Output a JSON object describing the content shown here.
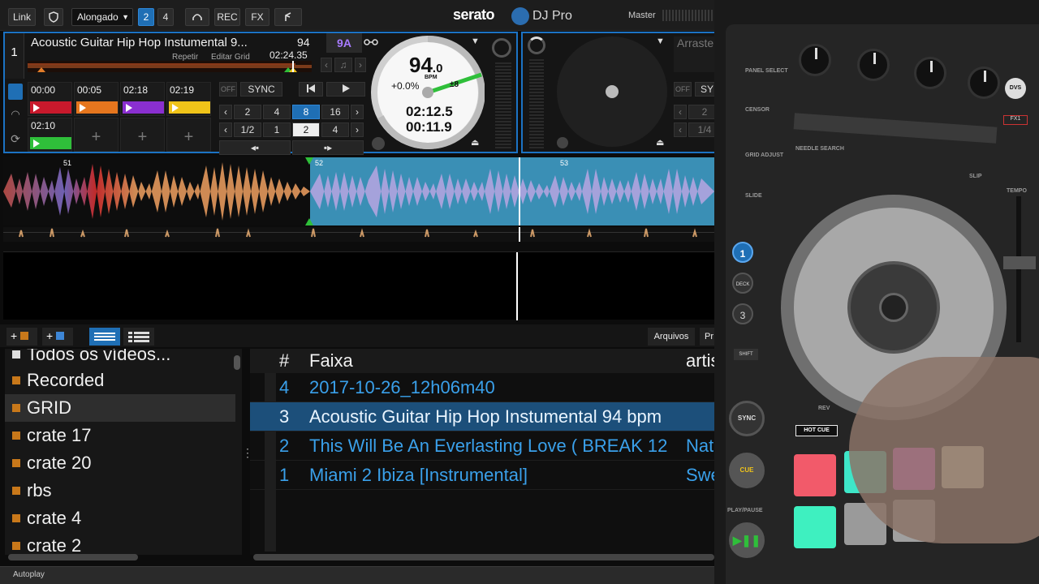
{
  "topbar": {
    "link": "Link",
    "mode_select": "Alongado",
    "deck_count_2": "2",
    "deck_count_4": "4",
    "rec": "REC",
    "fx": "FX",
    "brand": "serato",
    "brand_sub": "DJ Pro",
    "master": "Master"
  },
  "deck1": {
    "number": "1",
    "title": "Acoustic Guitar Hip Hop Instumental 9...",
    "bpm": "94",
    "key": "9A",
    "repeat": "Repetir",
    "edit_grid": "Editar Grid",
    "position": "02:24.35",
    "sync": "SYNC",
    "off": "OFF",
    "cues": [
      {
        "time": "00:00",
        "color": "#c8192c"
      },
      {
        "time": "00:05",
        "color": "#e6761e"
      },
      {
        "time": "02:18",
        "color": "#8a2fd0"
      },
      {
        "time": "02:19",
        "color": "#f0c419"
      },
      {
        "time": "02:10",
        "color": "#2fbf3a"
      }
    ],
    "loop_row1": [
      "2",
      "4",
      "8",
      "16"
    ],
    "loop_row2": [
      "1/2",
      "1",
      "2",
      "4"
    ],
    "platter": {
      "bpm": "94",
      "bpm_decimal": ".0",
      "bpm_label": "BPM",
      "pitch": "+0.0%",
      "range": "±8",
      "elapsed": "02:12.5",
      "remaining": "00:11.9"
    }
  },
  "deck2": {
    "placeholder": "Arraste",
    "off": "OFF",
    "sync": "SY",
    "loop_row1": [
      "2"
    ],
    "loop_row2": [
      "1/4"
    ]
  },
  "waveform": {
    "bar_markers": [
      "51",
      "52",
      "53"
    ]
  },
  "library": {
    "files_button": "Arquivos",
    "prepare_button": "Pr",
    "crates": [
      {
        "label": "Todos os vídeos..."
      },
      {
        "label": "Recorded"
      },
      {
        "label": "GRID",
        "selected": true
      },
      {
        "label": "crate 17"
      },
      {
        "label": "crate 20"
      },
      {
        "label": "rbs"
      },
      {
        "label": "crate 4"
      },
      {
        "label": "crate 2"
      }
    ],
    "columns": {
      "num": "#",
      "track": "Faixa",
      "artist": "artis"
    },
    "tracks": [
      {
        "num": "4",
        "track": "2017-10-26_12h06m40",
        "artist": ""
      },
      {
        "num": "3",
        "track": "Acoustic Guitar Hip Hop Instumental 94 bpm",
        "artist": "",
        "selected": true
      },
      {
        "num": "2",
        "track": "This Will Be An Everlasting Love ( BREAK 12",
        "artist": "Nat"
      },
      {
        "num": "1",
        "track": "Miami 2 Ibiza [Instrumental]",
        "artist": "Swe"
      }
    ],
    "autoplay": "Autoplay"
  },
  "controller": {
    "panel_select": "PANEL SELECT",
    "censor": "CENSOR",
    "grid_adjust": "GRID ADJUST",
    "slide": "SLIDE",
    "needle_search": "NEEDLE SEARCH",
    "deck1": "1",
    "deck": "DECK",
    "deck3": "3",
    "shift": "SHIFT",
    "sync": "SYNC",
    "cue": "CUE",
    "play_pause": "PLAY/PAUSE",
    "hot_cue": "HOT CUE",
    "fx1": "FX1",
    "dvs": "DVS",
    "tempo": "TEMPO",
    "slip": "SLIP",
    "rev": "REV",
    "pad_colors": [
      "#f25a6a",
      "#3ee6c8",
      "#ff5cf0",
      "#f0f0c8",
      "#3ef0c0",
      "#9a9a9a",
      "#a0a0a0"
    ]
  }
}
